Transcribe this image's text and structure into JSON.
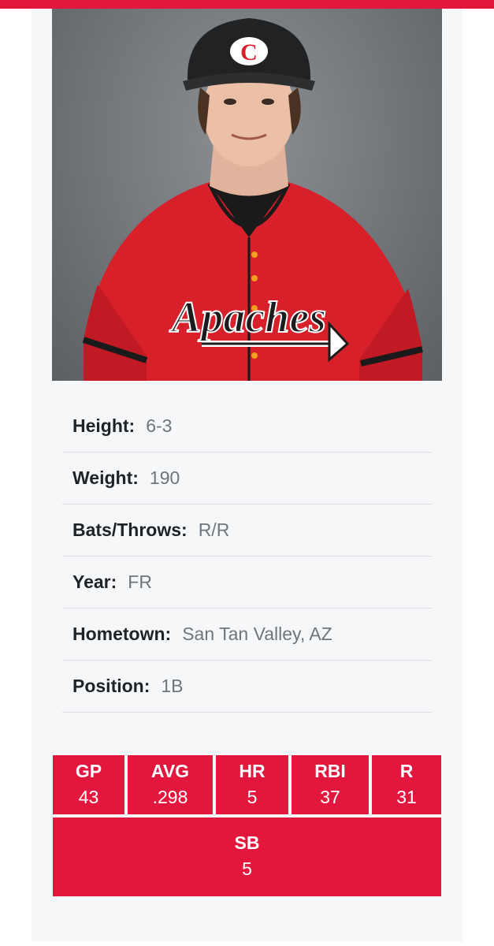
{
  "colors": {
    "accent": "#e3173e",
    "card_bg": "#f6f7f9"
  },
  "player": {
    "photo_cap_logo": "C",
    "jersey_text": "Apaches",
    "details": [
      {
        "label": "Height:",
        "value": "6-3"
      },
      {
        "label": "Weight:",
        "value": "190"
      },
      {
        "label": "Bats/Throws:",
        "value": "R/R"
      },
      {
        "label": "Year:",
        "value": "FR"
      },
      {
        "label": "Hometown:",
        "value": "San Tan Valley, AZ"
      },
      {
        "label": "Position:",
        "value": "1B"
      }
    ]
  },
  "stats": [
    {
      "label": "GP",
      "value": "43"
    },
    {
      "label": "AVG",
      "value": ".298"
    },
    {
      "label": "HR",
      "value": "5"
    },
    {
      "label": "RBI",
      "value": "37"
    },
    {
      "label": "R",
      "value": "31"
    },
    {
      "label": "SB",
      "value": "5"
    }
  ]
}
